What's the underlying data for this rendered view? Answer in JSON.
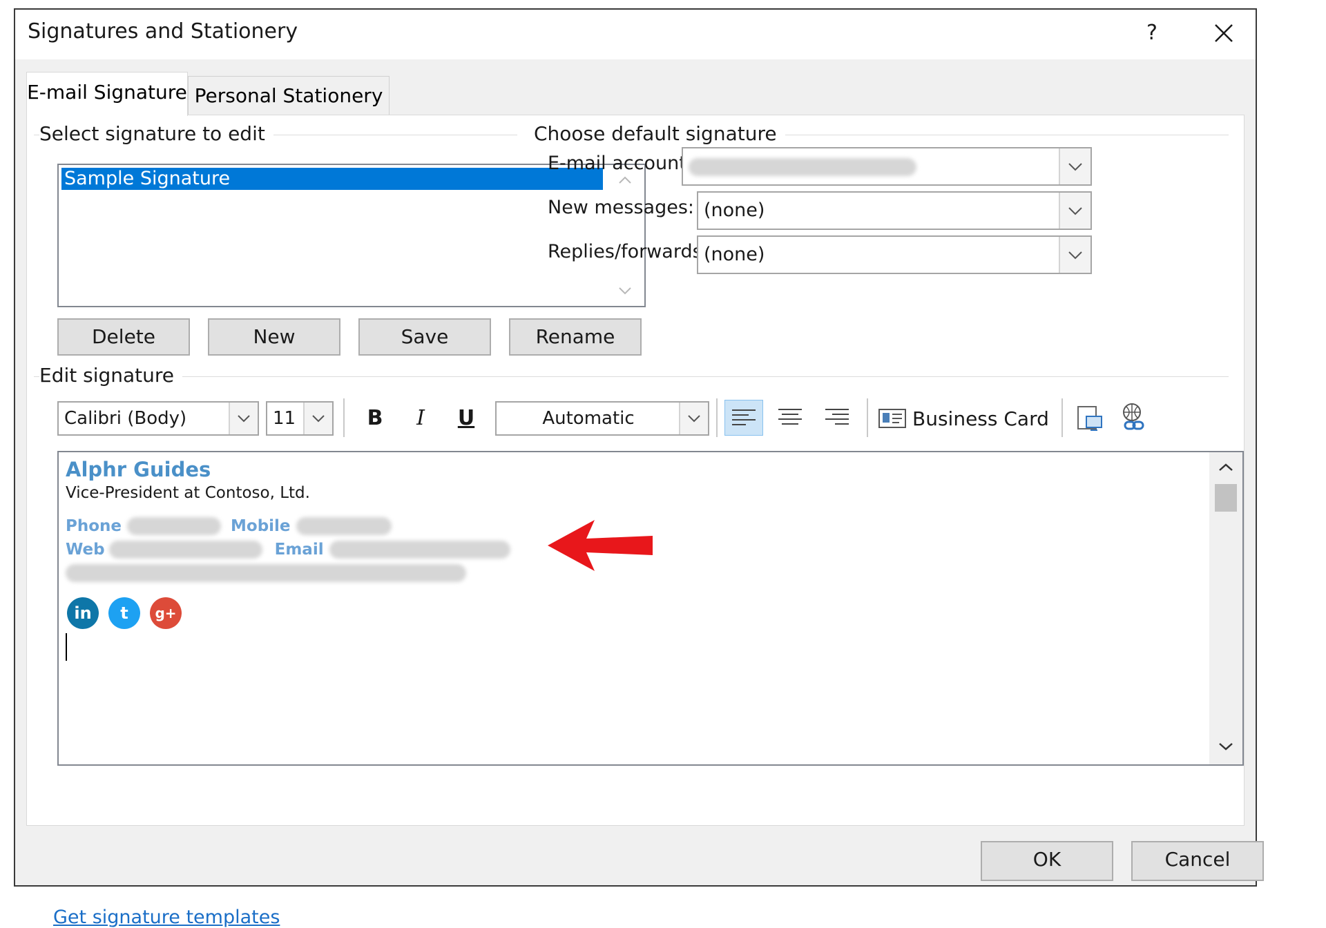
{
  "window": {
    "title": "Signatures and Stationery",
    "help_label": "?"
  },
  "tabs": [
    {
      "label": "E-mail Signature",
      "active": true
    },
    {
      "label": "Personal Stationery",
      "active": false
    }
  ],
  "select_section": {
    "label": "Select signature to edit",
    "signatures": [
      "Sample Signature"
    ],
    "selected": "Sample Signature",
    "buttons": {
      "delete": "Delete",
      "new": "New",
      "save": "Save",
      "rename": "Rename"
    }
  },
  "default_section": {
    "label": "Choose default signature",
    "email_account_label": "E-mail account:",
    "email_account_value": "",
    "new_messages_label": "New messages:",
    "new_messages_value": "(none)",
    "replies_label": "Replies/forwards:",
    "replies_value": "(none)"
  },
  "edit_section": {
    "label": "Edit signature",
    "font_name": "Calibri (Body)",
    "font_size": "11",
    "bold": "B",
    "italic": "I",
    "underline": "U",
    "color": "Automatic",
    "business_card": "Business Card"
  },
  "signature": {
    "name": "Alphr Guides",
    "title": "Vice-President at Contoso, Ltd.",
    "phone_label": "Phone",
    "mobile_label": "Mobile",
    "web_label": "Web",
    "email_label": "Email",
    "social": [
      {
        "icon": "linkedin-icon",
        "glyph": "in",
        "color": "#0e76a8"
      },
      {
        "icon": "twitter-icon",
        "glyph": "t",
        "color": "#1da1f2"
      },
      {
        "icon": "google-plus-icon",
        "glyph": "g+",
        "color": "#dd4b39"
      }
    ]
  },
  "annotation": {
    "arrow_color": "#e8171b"
  },
  "footer": {
    "templates_link": "Get signature templates",
    "ok": "OK",
    "cancel": "Cancel"
  },
  "colors": {
    "selection": "#0078d7",
    "signature_accent": "#4a90c8",
    "link": "#1a6ec7"
  }
}
